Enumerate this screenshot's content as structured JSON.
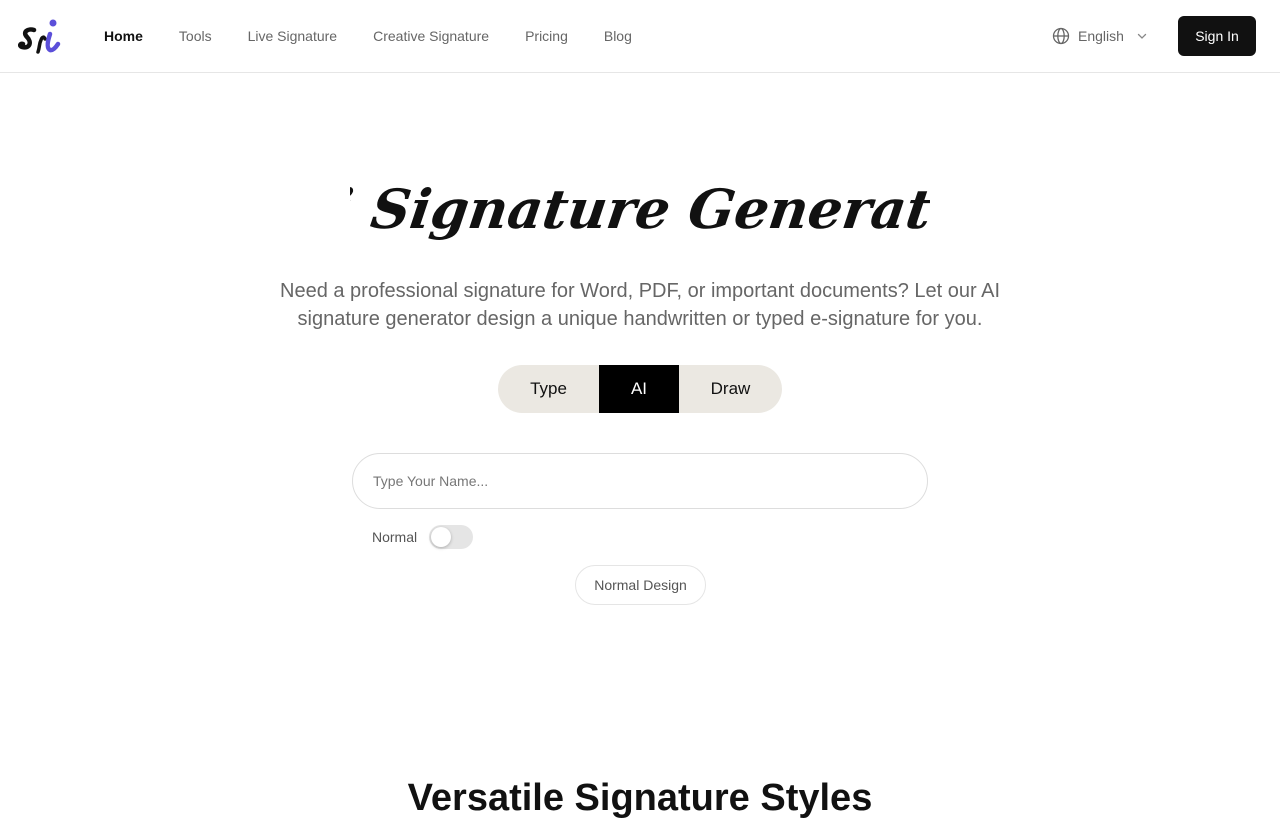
{
  "brand": {
    "logo_text": "si",
    "accent_color": "#5b4fd9"
  },
  "nav": {
    "items": [
      {
        "label": "Home",
        "active": true
      },
      {
        "label": "Tools",
        "active": false
      },
      {
        "label": "Live Signature",
        "active": false
      },
      {
        "label": "Creative Signature",
        "active": false
      },
      {
        "label": "Pricing",
        "active": false
      },
      {
        "label": "Blog",
        "active": false
      }
    ],
    "language": {
      "label": "English",
      "icon": "globe-icon"
    },
    "signin_label": "Sign In"
  },
  "hero": {
    "title": "Ai Signature Generator",
    "subtitle": "Need a professional signature for Word, PDF, or important documents? Let our AI signature generator design a unique handwritten or typed e-signature for you."
  },
  "mode_tabs": {
    "items": [
      {
        "label": "Type",
        "selected": false
      },
      {
        "label": "AI",
        "selected": true
      },
      {
        "label": "Draw",
        "selected": false
      }
    ]
  },
  "form": {
    "name_placeholder": "Type Your Name...",
    "name_value": "",
    "toggle_label": "Normal",
    "toggle_on": false,
    "design_button_label": "Normal Design"
  },
  "next_section": {
    "heading": "Versatile Signature Styles"
  }
}
